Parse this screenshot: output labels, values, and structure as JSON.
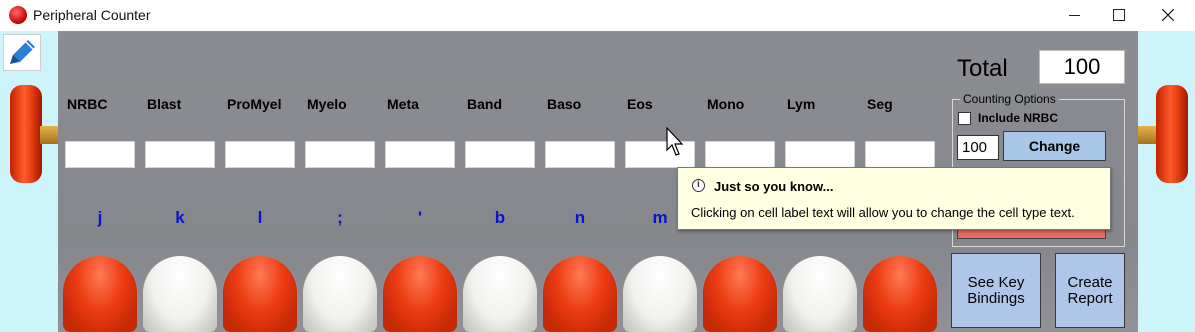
{
  "window": {
    "title": "Peripheral Counter",
    "icon": "red-blood-cell-icon"
  },
  "cells": [
    {
      "label": "NRBC",
      "key": "j",
      "button_color": "red",
      "value": ""
    },
    {
      "label": "Blast",
      "key": "k",
      "button_color": "white",
      "value": ""
    },
    {
      "label": "ProMyel",
      "key": "l",
      "button_color": "red",
      "value": ""
    },
    {
      "label": "Myelo",
      "key": ";",
      "button_color": "white",
      "value": ""
    },
    {
      "label": "Meta",
      "key": "'",
      "button_color": "red",
      "value": ""
    },
    {
      "label": "Band",
      "key": "b",
      "button_color": "white",
      "value": ""
    },
    {
      "label": "Baso",
      "key": "n",
      "button_color": "red",
      "value": ""
    },
    {
      "label": "Eos",
      "key": "m",
      "button_color": "white",
      "value": ""
    },
    {
      "label": "Mono",
      "key": "",
      "button_color": "red",
      "value": ""
    },
    {
      "label": "Lym",
      "key": "",
      "button_color": "white",
      "value": ""
    },
    {
      "label": "Seg",
      "key": "",
      "button_color": "red",
      "value": ""
    }
  ],
  "total": {
    "label": "Total",
    "value": "100"
  },
  "counting_options": {
    "title": "Counting Options",
    "include_nrbc_label": "Include NRBC",
    "include_nrbc_checked": false,
    "count_value": "100",
    "change_label": "Change"
  },
  "buttons": {
    "see_key_bindings": "See Key Bindings",
    "create_report": "Create Report"
  },
  "tooltip": {
    "title": "Just so you know...",
    "body": "Clicking on cell label text will allow you to change the cell type text."
  },
  "colors": {
    "panel": "#88898e",
    "key_text": "#0a14c8",
    "action_button": "#aec7e8",
    "counter_red": "#ec3b12",
    "background": "#cdf4fb"
  }
}
